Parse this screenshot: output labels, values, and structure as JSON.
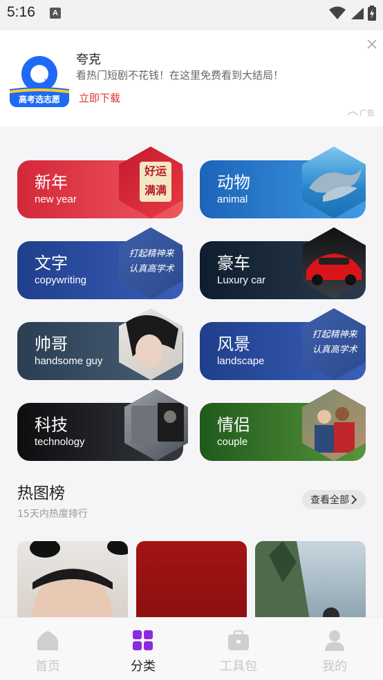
{
  "status_bar": {
    "time": "5:16",
    "notification_icon": "A"
  },
  "ad": {
    "app_name": "夸克",
    "description": "看热门短剧不花钱！在这里免费看到大结局！",
    "cta": "立即下载",
    "label": "广告",
    "logo_caption": "高考选志愿"
  },
  "categories": [
    {
      "zh": "新年",
      "en": "new year",
      "image_text": [
        "好运",
        "满满"
      ]
    },
    {
      "zh": "动物",
      "en": "animal"
    },
    {
      "zh": "文字",
      "en": "copywriting",
      "image_text": [
        "打起精神来",
        "认真高学术"
      ]
    },
    {
      "zh": "豪车",
      "en": "Luxury car"
    },
    {
      "zh": "帅哥",
      "en": "handsome guy"
    },
    {
      "zh": "风景",
      "en": "landscape",
      "image_text": [
        "打起精神来",
        "认真高学术"
      ]
    },
    {
      "zh": "科技",
      "en": "technology"
    },
    {
      "zh": "情侣",
      "en": "couple"
    }
  ],
  "hot": {
    "title": "热图榜",
    "subtitle": "15天内热度排行",
    "view_all": "查看全部"
  },
  "nav": [
    {
      "label": "首页",
      "icon": "home-icon",
      "active": false
    },
    {
      "label": "分类",
      "icon": "grid-icon",
      "active": true
    },
    {
      "label": "工具包",
      "icon": "toolbox-icon",
      "active": false
    },
    {
      "label": "我的",
      "icon": "user-icon",
      "active": false
    }
  ],
  "colors": {
    "accent": "#8a2be2",
    "cta_red": "#e0342e"
  }
}
